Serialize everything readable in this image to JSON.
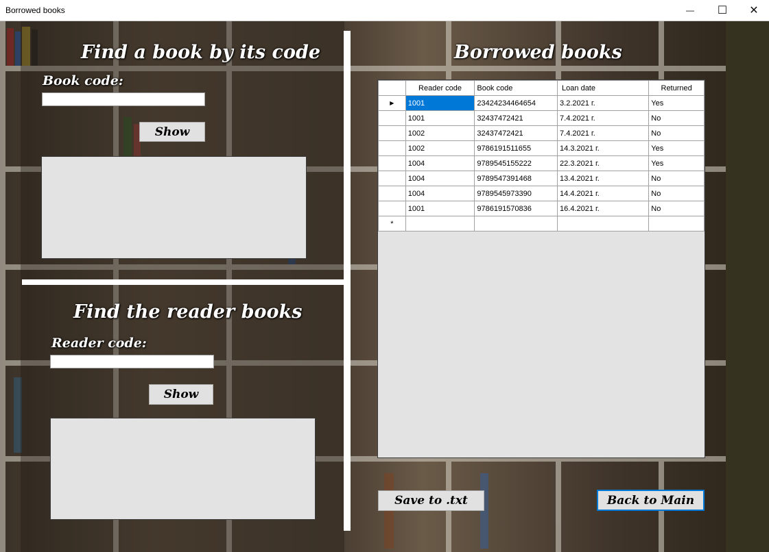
{
  "window": {
    "title": "Borrowed books",
    "minimize_glyph": "—",
    "maximize_glyph": "☐",
    "close_glyph": "✕"
  },
  "find_by_code": {
    "heading": "Find a book by its code",
    "label": "Book code:",
    "input_value": "",
    "show_label": "Show"
  },
  "find_reader": {
    "heading": "Find the reader books",
    "label": "Reader code:",
    "input_value": "",
    "show_label": "Show"
  },
  "borrowed": {
    "heading": "Borrowed books",
    "columns": [
      "Reader code",
      "Book code",
      "Loan date",
      "Returned"
    ],
    "rows": [
      [
        "1001",
        "23424234464654",
        "3.2.2021 г.",
        "Yes"
      ],
      [
        "1001",
        "32437472421",
        "7.4.2021 г.",
        "No"
      ],
      [
        "1002",
        "32437472421",
        "7.4.2021 г.",
        "No"
      ],
      [
        "1002",
        "9786191511655",
        "14.3.2021 г.",
        "Yes"
      ],
      [
        "1004",
        "9789545155222",
        "22.3.2021 г.",
        "Yes"
      ],
      [
        "1004",
        "9789547391468",
        "13.4.2021 г.",
        "No"
      ],
      [
        "1004",
        "9789545973390",
        "14.4.2021 г.",
        "No"
      ],
      [
        "1001",
        "9786191570836",
        "16.4.2021 г.",
        "No"
      ]
    ],
    "current_row_glyph": "▶",
    "new_row_glyph": "*"
  },
  "buttons": {
    "save_label": "Save to .txt",
    "back_label": "Back to Main"
  },
  "colors": {
    "selection": "#0078d7",
    "panel": "#e3e3e3",
    "button": "#e1e1e1"
  }
}
